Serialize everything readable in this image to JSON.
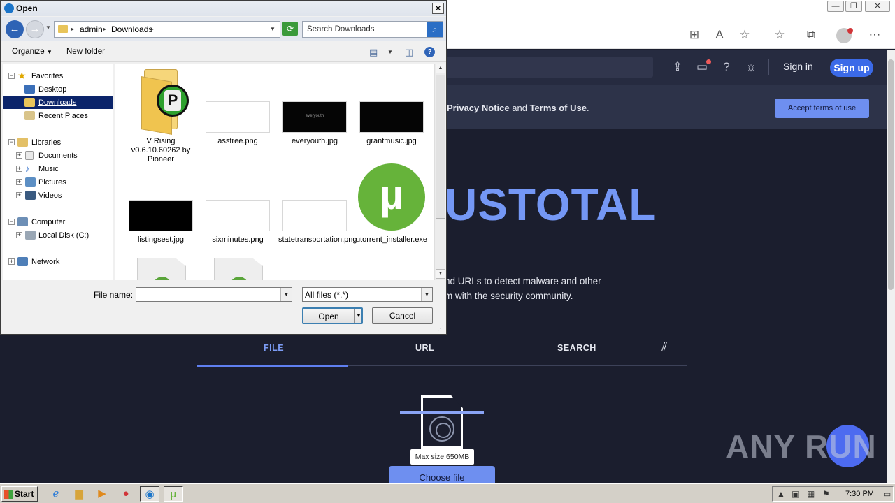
{
  "browser": {
    "window_controls": {
      "minimize": "—",
      "restore": "❐",
      "close": "✕"
    },
    "toolbar_icons": [
      "split-screen-icon",
      "read-aloud-icon",
      "add-favorite-icon",
      "favorites-icon",
      "collections-icon",
      "profile-icon",
      "more-icon"
    ]
  },
  "virustotal": {
    "header": {
      "sign_in": "Sign in",
      "sign_up": "Sign up"
    },
    "banner": {
      "privacy": "Privacy Notice",
      "and": "and",
      "terms": "Terms of Use",
      "period": ".",
      "accept": "Accept terms of use"
    },
    "logo_text": "USTOTAL",
    "description_line1": "nd URLs to detect malware and other",
    "description_line2": "m with the security community.",
    "tabs": {
      "file": "FILE",
      "url": "URL",
      "search": "SEARCH"
    },
    "upload": {
      "max_size": "Max size 650MB",
      "choose_file": "Choose file"
    },
    "watermark": "ANY RUN"
  },
  "dialog": {
    "title": "Open",
    "close": "✕",
    "address": {
      "crumbs": [
        "admin",
        "Downloads"
      ]
    },
    "search": {
      "placeholder": "Search Downloads"
    },
    "commands": {
      "organize": "Organize",
      "new_folder": "New folder",
      "help": "?"
    },
    "tree": {
      "favorites": "Favorites",
      "desktop": "Desktop",
      "downloads": "Downloads",
      "recent_places": "Recent Places",
      "libraries": "Libraries",
      "documents": "Documents",
      "music": "Music",
      "pictures": "Pictures",
      "videos": "Videos",
      "computer": "Computer",
      "local_disk": "Local Disk (C:)",
      "network": "Network"
    },
    "files": [
      {
        "label": "V Rising v0.6.10.60262 by Pioneer"
      },
      {
        "label": "asstree.png"
      },
      {
        "label": "everyouth.jpg"
      },
      {
        "label": "grantmusic.jpg"
      },
      {
        "label": "listingsest.jpg"
      },
      {
        "label": "sixminutes.png"
      },
      {
        "label": "statetransportation.png"
      },
      {
        "label": "utorrent_installer.exe"
      }
    ],
    "thumb_texts": {
      "everyouth": "everyouth"
    },
    "file_name_label": "File name:",
    "file_name_value": "",
    "filter": "All files (*.*)",
    "open_button": "Open",
    "cancel_button": "Cancel"
  },
  "taskbar": {
    "start": "Start",
    "clock": "7:30 PM"
  }
}
